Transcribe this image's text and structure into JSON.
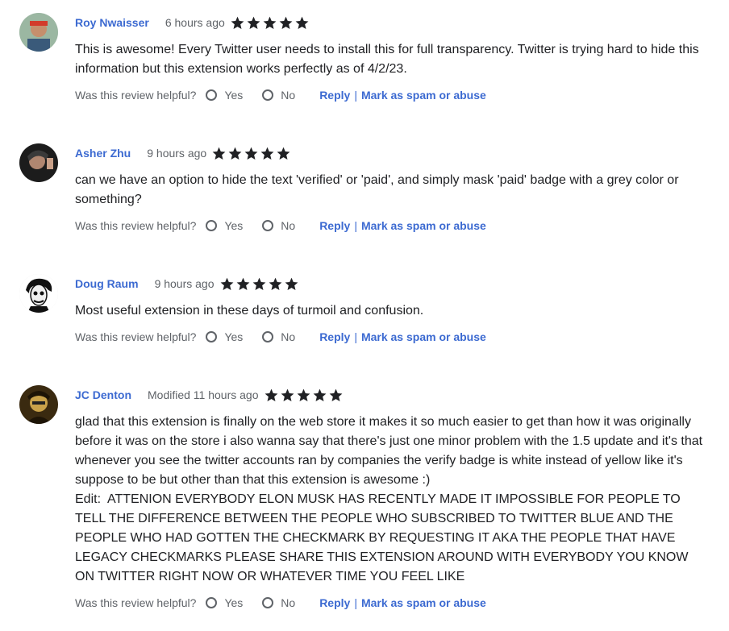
{
  "colors": {
    "link": "#3c6ad1",
    "muted": "#5f6368",
    "text": "#202124",
    "star": "#202124"
  },
  "labels": {
    "helpful_question": "Was this review helpful?",
    "yes": "Yes",
    "no": "No",
    "reply": "Reply",
    "separator": "|",
    "spam": "Mark as spam or abuse"
  },
  "reviews": [
    {
      "author": "Roy Nwaisser",
      "time": "6 hours ago",
      "rating": 5,
      "avatar_icon": "user-photo-icon",
      "text": "This is awesome! Every Twitter user needs to install this for full transparency. Twitter is trying hard to hide this information but this extension works perfectly as of 4/2/23."
    },
    {
      "author": "Asher Zhu",
      "time": "9 hours ago",
      "rating": 5,
      "avatar_icon": "user-photo-icon",
      "text": "can we have an option to hide the text 'verified' or 'paid', and simply mask 'paid' badge with a grey color or something?"
    },
    {
      "author": "Doug Raum",
      "time": "9 hours ago",
      "rating": 5,
      "avatar_icon": "user-photo-icon",
      "text": "Most useful extension in these days of turmoil and confusion."
    },
    {
      "author": "JC Denton",
      "time": "Modified 11 hours ago",
      "rating": 5,
      "avatar_icon": "user-photo-icon",
      "text": "glad that this extension is finally on the web store it makes it so much easier to get than how it was originally before it was on the store i also wanna say that there's just one minor problem with the 1.5 update and it's that whenever you see the twitter accounts ran by companies the verify badge is white instead of yellow like it's suppose to be but other than that this extension is awesome :)\nEdit:  ATTENION EVERYBODY ELON MUSK HAS RECENTLY MADE IT IMPOSSIBLE FOR PEOPLE TO TELL THE DIFFERENCE BETWEEN THE PEOPLE WHO SUBSCRIBED TO TWITTER BLUE AND THE PEOPLE WHO HAD GOTTEN THE CHECKMARK BY REQUESTING IT AKA THE PEOPLE THAT HAVE LEGACY CHECKMARKS PLEASE SHARE THIS EXTENSION AROUND WITH EVERYBODY YOU KNOW ON TWITTER RIGHT NOW OR WHATEVER TIME YOU FEEL LIKE"
    }
  ]
}
